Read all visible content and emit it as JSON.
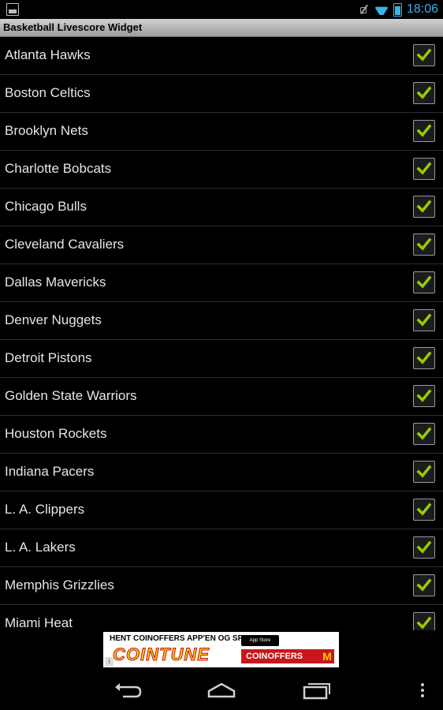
{
  "status_bar": {
    "time": "18:06",
    "icons": [
      "image-icon",
      "muted-icon",
      "wifi-icon",
      "battery-icon"
    ]
  },
  "app": {
    "title": "Basketball Livescore Widget"
  },
  "teams": [
    {
      "name": "Atlanta Hawks",
      "checked": true
    },
    {
      "name": "Boston Celtics",
      "checked": true
    },
    {
      "name": "Brooklyn Nets",
      "checked": true
    },
    {
      "name": "Charlotte Bobcats",
      "checked": true
    },
    {
      "name": "Chicago Bulls",
      "checked": true
    },
    {
      "name": "Cleveland Cavaliers",
      "checked": true
    },
    {
      "name": "Dallas Mavericks",
      "checked": true
    },
    {
      "name": "Denver Nuggets",
      "checked": true
    },
    {
      "name": "Detroit Pistons",
      "checked": true
    },
    {
      "name": "Golden State Warriors",
      "checked": true
    },
    {
      "name": "Houston Rockets",
      "checked": true
    },
    {
      "name": "Indiana Pacers",
      "checked": true
    },
    {
      "name": "L. A. Clippers",
      "checked": true
    },
    {
      "name": "L. A. Lakers",
      "checked": true
    },
    {
      "name": "Memphis Grizzlies",
      "checked": true
    },
    {
      "name": "Miami Heat",
      "checked": true
    }
  ],
  "ad": {
    "headline": "HENT COINOFFERS APP'EN OG SPIL",
    "logo": "COINTUNE",
    "store_badge": "App Store",
    "brand": "COINOFFERS",
    "mark": "M"
  },
  "colors": {
    "accent": "#33b5e5",
    "check": "#99cc00",
    "title_bar": "#b5b5b5"
  }
}
